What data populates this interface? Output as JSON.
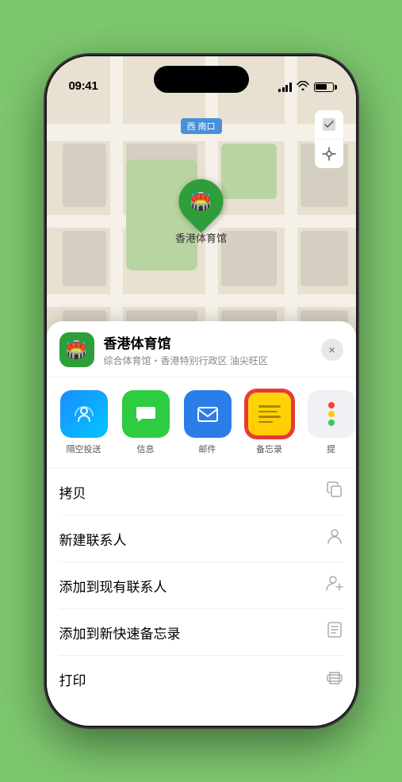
{
  "status_bar": {
    "time": "09:41",
    "nav_arrow": "▶"
  },
  "map": {
    "label": "南口",
    "label_prefix": "西"
  },
  "venue": {
    "name": "香港体育馆",
    "description": "综合体育馆・香港特别行政区 油尖旺区",
    "icon": "🏟️"
  },
  "share_items": [
    {
      "id": "airdrop",
      "label": "隔空投送"
    },
    {
      "id": "messages",
      "label": "信息"
    },
    {
      "id": "mail",
      "label": "邮件"
    },
    {
      "id": "notes",
      "label": "备忘录"
    },
    {
      "id": "more",
      "label": "提"
    }
  ],
  "actions": [
    {
      "id": "copy",
      "label": "拷贝",
      "icon": "copy"
    },
    {
      "id": "new-contact",
      "label": "新建联系人",
      "icon": "person"
    },
    {
      "id": "add-existing",
      "label": "添加到现有联系人",
      "icon": "person-add"
    },
    {
      "id": "add-notes",
      "label": "添加到新快速备忘录",
      "icon": "note"
    },
    {
      "id": "print",
      "label": "打印",
      "icon": "print"
    }
  ],
  "more_dots_colors": [
    "#ff3b30",
    "#ffcc00",
    "#34c759"
  ],
  "close_label": "×"
}
